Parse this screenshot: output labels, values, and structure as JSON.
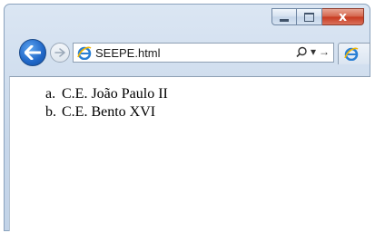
{
  "window": {
    "buttons": {
      "minimize_icon": "minimize-icon",
      "maximize_icon": "maximize-icon",
      "close_icon": "close-icon",
      "close_label": "x"
    }
  },
  "toolbar": {
    "address_value": "SEEPE.html",
    "search_icon": "search-icon",
    "dropdown_label": "▾",
    "go_label": "→"
  },
  "content": {
    "list": [
      {
        "marker": "a.",
        "text": "C.E. João Paulo II"
      },
      {
        "marker": "b.",
        "text": "C.E. Bento XVI"
      }
    ]
  },
  "colors": {
    "chrome": "#c7d7ea",
    "back_button": "#1f66c7",
    "close_button": "#c7391f"
  }
}
